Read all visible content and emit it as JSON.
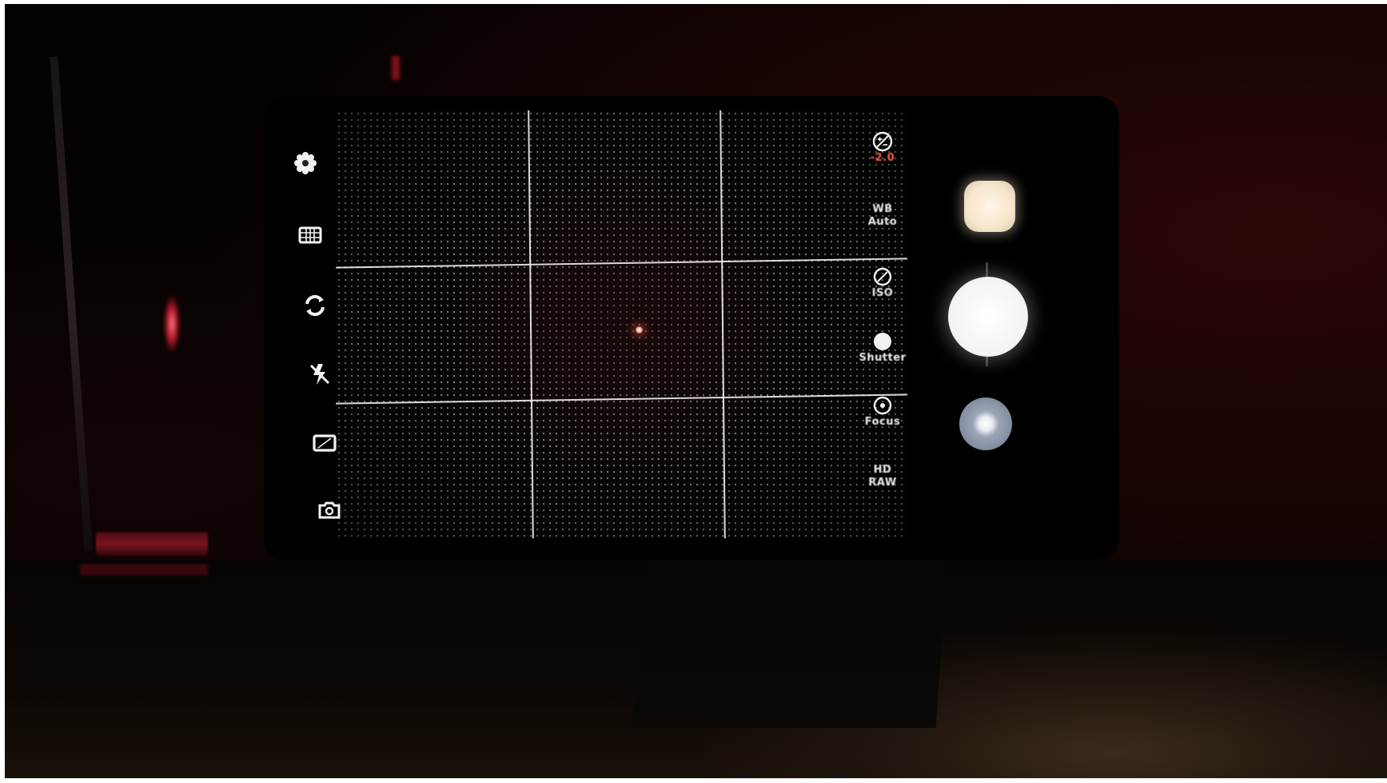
{
  "camera_app": {
    "left_controls": [
      {
        "name": "settings-icon"
      },
      {
        "name": "grid-icon"
      },
      {
        "name": "switch-camera-icon"
      },
      {
        "name": "flash-off-icon"
      },
      {
        "name": "aspect-ratio-icon"
      },
      {
        "name": "mode-camera-icon"
      }
    ],
    "right_settings": {
      "exposure": {
        "icon": "exposure-icon",
        "value": "-2.0"
      },
      "white_balance": {
        "label_top": "WB",
        "label_bottom": "Auto"
      },
      "iso": {
        "icon": "iso-icon",
        "label": "ISO"
      },
      "shutter_speed": {
        "icon": "shutter-speed-icon",
        "label": "Shutter"
      },
      "focus": {
        "icon": "focus-icon",
        "label": "Focus"
      },
      "format": {
        "label_top": "HD",
        "label_bottom": "RAW"
      }
    },
    "accent_color": "#ff5a4a"
  }
}
